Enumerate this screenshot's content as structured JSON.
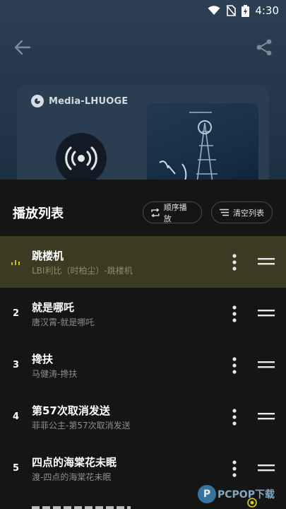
{
  "status_bar": {
    "time": "4:30"
  },
  "player_bg": {
    "brand_text": "Media-LHUOGE"
  },
  "playlist": {
    "title": "播放列表",
    "order_button_label": "顺序播放",
    "clear_button_label": "清空列表",
    "items": [
      {
        "index": "",
        "title": "跳楼机",
        "subtitle": "LBI利比（时柏尘）-跳楼机",
        "playing": true
      },
      {
        "index": "2",
        "title": "就是哪吒",
        "subtitle": "唐汉霄-就是哪吒",
        "playing": false
      },
      {
        "index": "3",
        "title": "搀扶",
        "subtitle": "马健涛-搀扶",
        "playing": false
      },
      {
        "index": "4",
        "title": "第57次取消发送",
        "subtitle": "菲菲公主-第57次取消发送",
        "playing": false
      },
      {
        "index": "5",
        "title": "四点的海棠花未眠",
        "subtitle": "渡-四点的海棠花未眠",
        "playing": false
      }
    ]
  },
  "watermark": {
    "text": "PCPOP下载"
  },
  "colors": {
    "active_row": "#3a3b22",
    "playing_indicator": "#c8c21a",
    "sheet_bg": "#151515"
  }
}
